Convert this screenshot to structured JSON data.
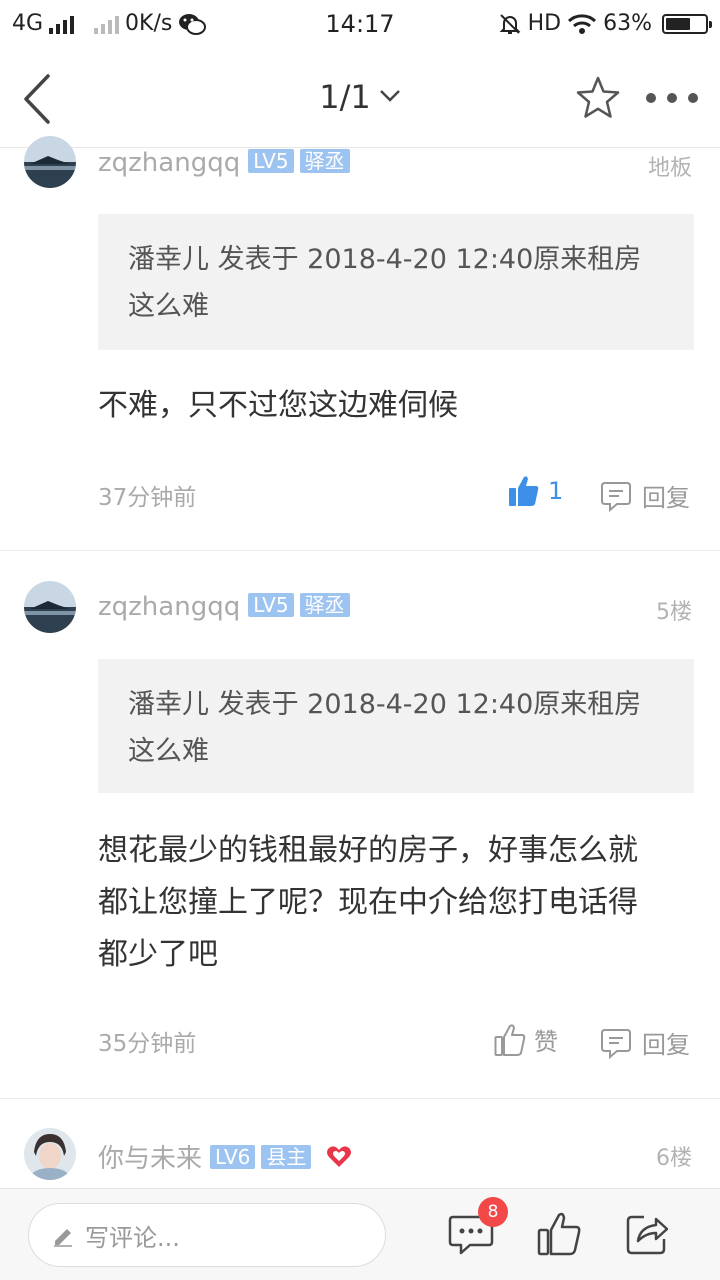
{
  "status_bar": {
    "network": "4G",
    "speed": "0K/s",
    "time": "14:17",
    "hd": "HD",
    "battery": "63%",
    "battery_level": 0.63
  },
  "header": {
    "page_indicator": "1/1"
  },
  "posts": [
    {
      "username": "zqzhangqq",
      "level": "LV5",
      "title_badge": "驿丞",
      "floor": "地板",
      "quote": "潘幸儿 发表于 2018-4-20 12:40原来租房这么难",
      "content": "不难，只不过您这边难伺候",
      "time": "37分钟前",
      "like_label": "1",
      "liked": true,
      "reply_label": "回复"
    },
    {
      "username": "zqzhangqq",
      "level": "LV5",
      "title_badge": "驿丞",
      "floor": "5楼",
      "quote": "潘幸儿 发表于 2018-4-20 12:40原来租房这么难",
      "content": "想花最少的钱租最好的房子，好事怎么就都让您撞上了呢？现在中介给您打电话得都少了吧",
      "time": "35分钟前",
      "like_label": "赞",
      "liked": false,
      "reply_label": "回复"
    },
    {
      "username": "你与未来",
      "level": "LV6",
      "title_badge": "县主",
      "floor": "6楼"
    }
  ],
  "bottom_bar": {
    "comment_placeholder": "写评论...",
    "comment_count": "8"
  },
  "colors": {
    "accent_blue": "#3d8fe8",
    "badge_blue": "#9dc3f0",
    "red_badge": "#f24848",
    "heart": "#e8364a"
  }
}
